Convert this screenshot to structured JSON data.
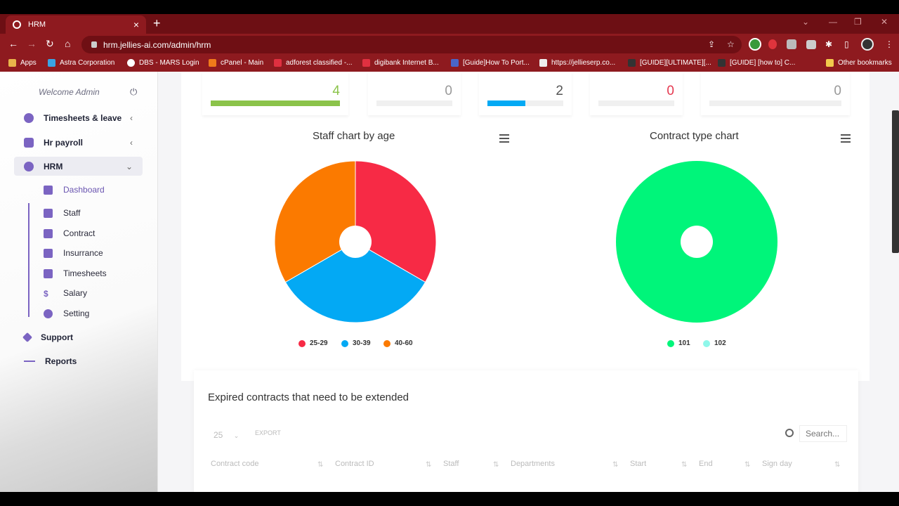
{
  "browser": {
    "tab_title": "HRM",
    "url": "hrm.jellies-ai.com/admin/hrm",
    "bookmarks": [
      "Apps",
      "Astra Corporation",
      "DBS - MARS Login",
      "cPanel - Main",
      "adforest classified -...",
      "digibank Internet B...",
      "[Guide]How To Port...",
      "https://jellieserp.co...",
      "[GUIDE][ULTIMATE][...",
      "[GUIDE] [how to] C...",
      "Other bookmarks"
    ]
  },
  "sidebar": {
    "welcome": "Welcome Admin",
    "items": [
      {
        "label": "Timesheets & leave"
      },
      {
        "label": "Hr payroll"
      },
      {
        "label": "HRM"
      },
      {
        "label": "Support"
      },
      {
        "label": "Reports"
      }
    ],
    "hrm_sub": [
      {
        "label": "Dashboard"
      },
      {
        "label": "Staff"
      },
      {
        "label": "Contract"
      },
      {
        "label": "Insurrance"
      },
      {
        "label": "Timesheets"
      },
      {
        "label": "Salary"
      },
      {
        "label": "Setting"
      }
    ]
  },
  "stats": [
    {
      "value": "4",
      "color": "#8bc34a",
      "progress": 1.0
    },
    {
      "value": "0",
      "color": "#999999",
      "progress": 0
    },
    {
      "value": "2",
      "color": "#03a9f4",
      "progress": 0.5
    },
    {
      "value": "0",
      "color": "#e53950",
      "progress": 0
    },
    {
      "value": "0",
      "color": "#999999",
      "progress": 0
    }
  ],
  "chart_data": [
    {
      "type": "pie",
      "title": "Staff chart by age",
      "categories": [
        "25-29",
        "30-39",
        "40-60"
      ],
      "values": [
        1,
        1,
        1
      ],
      "colors": [
        "#f72a45",
        "#03a9f4",
        "#fb7a00"
      ]
    },
    {
      "type": "pie",
      "title": "Contract type chart",
      "categories": [
        "101",
        "102"
      ],
      "values": [
        1,
        0
      ],
      "colors": [
        "#00f57a",
        "#8ff7ea"
      ]
    }
  ],
  "table": {
    "title": "Expired contracts that need to be extended",
    "page_size": "25",
    "export_label": "EXPORT",
    "search_placeholder": "Search...",
    "columns": [
      "Contract code",
      "Contract ID",
      "Staff",
      "Departments",
      "Start",
      "End",
      "Sign day"
    ]
  }
}
